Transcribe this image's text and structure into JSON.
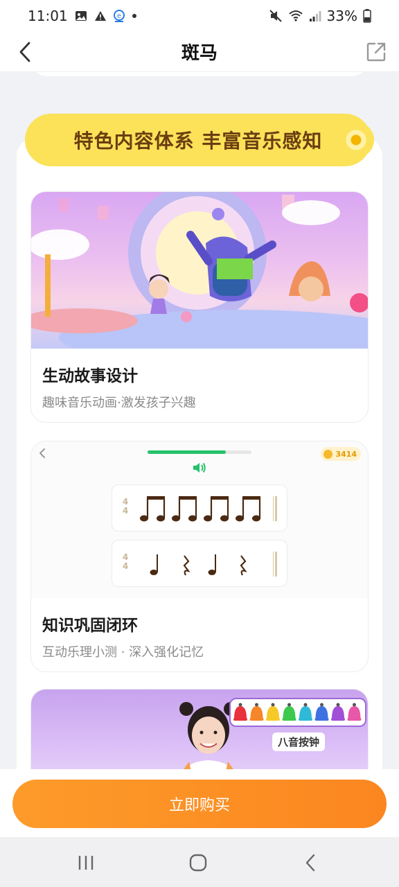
{
  "status_bar": {
    "time": "11:01",
    "battery": "33%",
    "icons": [
      "image-icon",
      "alert-icon",
      "app-icon",
      "dot-icon",
      "mute-icon",
      "wifi-icon",
      "signal-icon",
      "battery-icon"
    ]
  },
  "nav": {
    "title": "斑马",
    "back_icon": "chevron-left-icon",
    "share_icon": "share-icon"
  },
  "section": {
    "banner": "特色内容体系 丰富音乐感知"
  },
  "cards": [
    {
      "title": "生动故事设计",
      "subtitle": "趣味音乐动画·激发孩子兴趣"
    },
    {
      "title": "知识巩固闭环",
      "subtitle": "互动乐理小测 · 深入强化记忆"
    }
  ],
  "quiz": {
    "coins": "3414",
    "progress": 0.75,
    "time_signature_top": "4",
    "time_signature_bottom": "4"
  },
  "piano": {
    "label": "八音按钟",
    "bell_colors": [
      "#e8323c",
      "#f5862a",
      "#f6c928",
      "#3cc94d",
      "#2fb9d8",
      "#3f72e0",
      "#a14fd6",
      "#e957a8"
    ]
  },
  "bottom": {
    "buy_label": "立即购买"
  },
  "system_nav": {
    "icons": [
      "recent-apps-icon",
      "home-icon",
      "back-icon"
    ]
  }
}
